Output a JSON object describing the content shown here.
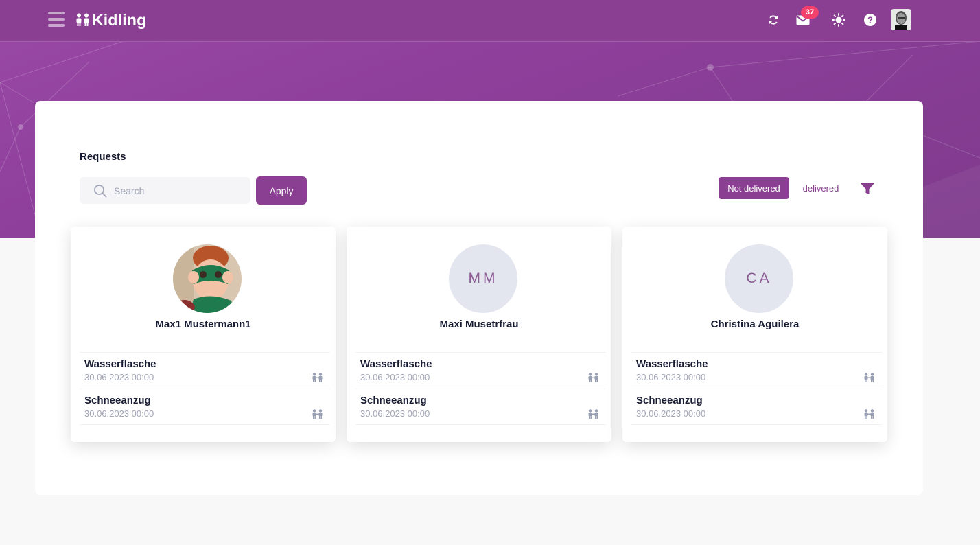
{
  "app": {
    "logo_text": "Kidling",
    "notification_count": "37"
  },
  "colors": {
    "brand": "#8b3f93",
    "badge": "#f1416c",
    "avatar_bg": "#e4e6ef"
  },
  "page": {
    "title": "Requests"
  },
  "search": {
    "placeholder": "Search",
    "value": ""
  },
  "apply_label": "Apply",
  "filters": {
    "not_delivered": "Not delivered",
    "delivered": "delivered",
    "active": "Not delivered"
  },
  "cards": [
    {
      "name": "Max1 Mustermann1",
      "initials": "",
      "has_photo": true,
      "requests": [
        {
          "title": "Wasserflasche",
          "date": "30.06.2023 00:00"
        },
        {
          "title": "Schneeanzug",
          "date": "30.06.2023 00:00"
        }
      ]
    },
    {
      "name": "Maxi Musetrfrau",
      "initials": "MM",
      "has_photo": false,
      "requests": [
        {
          "title": "Wasserflasche",
          "date": "30.06.2023 00:00"
        },
        {
          "title": "Schneeanzug",
          "date": "30.06.2023 00:00"
        }
      ]
    },
    {
      "name": "Christina Aguilera",
      "initials": "CA",
      "has_photo": false,
      "requests": [
        {
          "title": "Wasserflasche",
          "date": "30.06.2023 00:00"
        },
        {
          "title": "Schneeanzug",
          "date": "30.06.2023 00:00"
        }
      ]
    }
  ]
}
